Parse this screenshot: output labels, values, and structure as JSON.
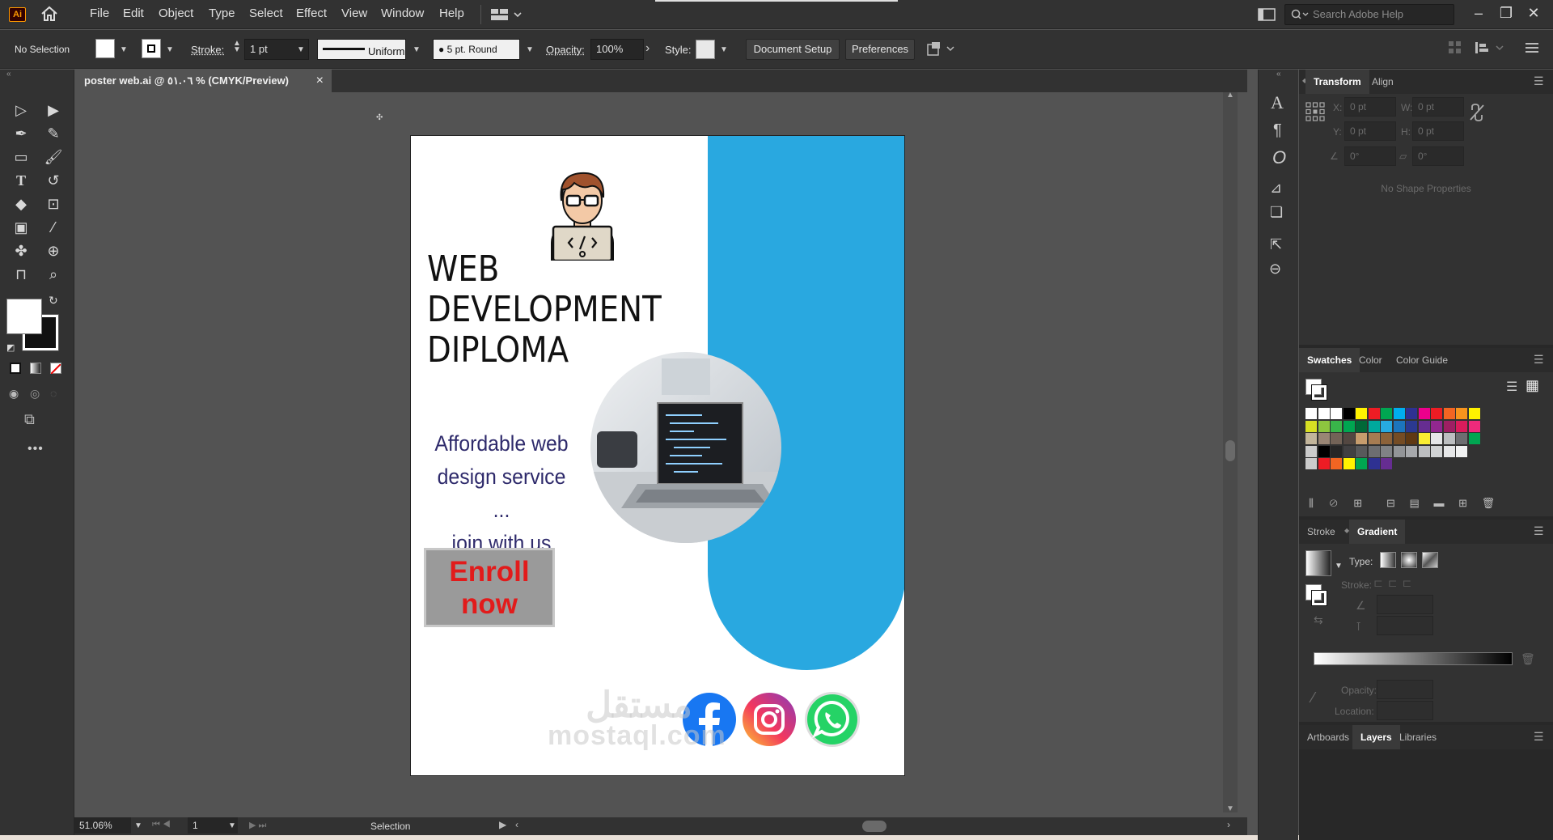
{
  "app": {
    "logo": "Ai"
  },
  "menubar": {
    "items": [
      "File",
      "Edit",
      "Object",
      "Type",
      "Select",
      "Effect",
      "View",
      "Window",
      "Help"
    ],
    "search_placeholder": "Search Adobe Help"
  },
  "control": {
    "selection_label": "No Selection",
    "stroke_label": "Stroke:",
    "stroke_value": "1 pt",
    "profile_label": "Uniform",
    "brush_label": "5 pt. Round",
    "opacity_label": "Opacity:",
    "opacity_value": "100%",
    "style_label": "Style:",
    "doc_setup_label": "Document Setup",
    "preferences_label": "Preferences"
  },
  "document": {
    "tab_title": "poster web.ai @ ٥١.٠٦ % (CMYK/Preview)",
    "close": "×"
  },
  "poster": {
    "title_lines": [
      "WEB",
      "DEVELOPMENT",
      "DIPLOMA"
    ],
    "tagline_lines": [
      "Affordable web",
      "design service ...",
      "join with us"
    ],
    "cta_lines": [
      "Enroll",
      "now"
    ],
    "accent_color": "#29a8e0",
    "cta_color": "#e21b1b",
    "social_icons": [
      "facebook-icon",
      "instagram-icon",
      "whatsapp-icon"
    ],
    "watermark_arabic": "مستقل",
    "watermark_latin": "mostaql.com"
  },
  "status": {
    "zoom": "51.06%",
    "artboard_num": "1",
    "tool": "Selection"
  },
  "panels": {
    "transform": {
      "tabs": [
        "Transform",
        "Align"
      ],
      "x": "0 pt",
      "y": "0 pt",
      "w": "0 pt",
      "h": "0 pt",
      "angle": "0°",
      "shear": "0°",
      "x_label": "X:",
      "y_label": "Y:",
      "w_label": "W:",
      "h_label": "H:",
      "empty_message": "No Shape Properties"
    },
    "swatches": {
      "tabs": [
        "Swatches",
        "Color",
        "Color Guide"
      ]
    },
    "gradient": {
      "tabs": [
        "Stroke",
        "Gradient"
      ],
      "type_label": "Type:",
      "stroke_label": "Stroke:",
      "opacity_label": "Opacity:",
      "location_label": "Location:"
    },
    "bottom_tabs": [
      "Artboards",
      "Layers",
      "Libraries"
    ]
  }
}
